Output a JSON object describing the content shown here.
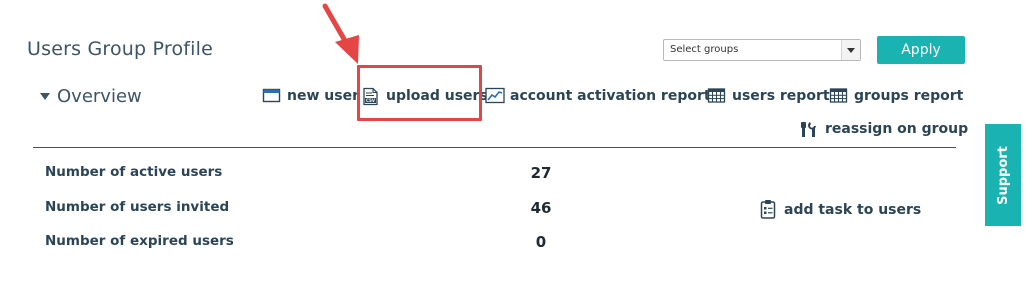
{
  "header": {
    "title": "Users Group Profile",
    "group_select": {
      "selected": "Select groups"
    },
    "apply_label": "Apply"
  },
  "overview": {
    "heading": "Overview",
    "actions": [
      {
        "label": "new user",
        "icon": "window-icon"
      },
      {
        "label": "upload users",
        "icon": "csv-file-icon"
      },
      {
        "label": "account activation report",
        "icon": "line-chart-icon"
      },
      {
        "label": "users report",
        "icon": "table-grid-icon"
      },
      {
        "label": "groups report",
        "icon": "table-grid-icon"
      }
    ],
    "reassign_label": "reassign on group",
    "reassign_icon": "reassign-tools-icon"
  },
  "stats": [
    {
      "label": "Number of active users",
      "value": "27"
    },
    {
      "label": "Number of users invited",
      "value": "46"
    },
    {
      "label": "Number of expired users",
      "value": "0"
    }
  ],
  "task_action": {
    "label": "add task to users",
    "icon": "clipboard-icon"
  },
  "support_label": "Support",
  "annotation": {
    "arrow_color": "#e64545",
    "box_color": "#e64545"
  },
  "colors": {
    "accent": "#19b4b1",
    "text": "#2b4556"
  }
}
